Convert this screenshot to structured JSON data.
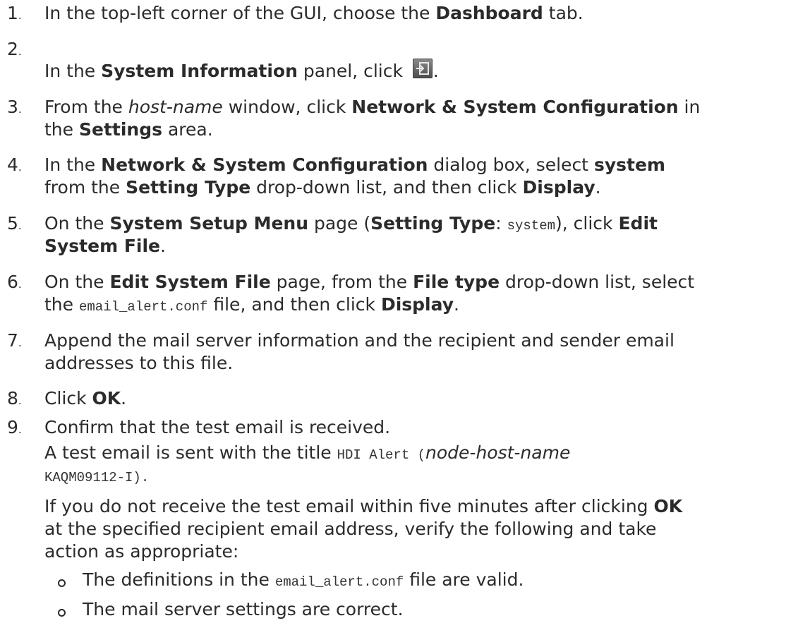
{
  "steps": [
    {
      "num": "1",
      "parts": [
        "In the top-left corner of the GUI, choose the ",
        "Dashboard",
        " tab."
      ]
    },
    {
      "num": "2",
      "parts": [
        "In the ",
        "System Information",
        " panel, click ",
        "."
      ],
      "icon": "panel-open-icon"
    },
    {
      "num": "3",
      "line1": [
        "From the ",
        "host-name",
        " window, click ",
        "Network & System Configuration",
        " in"
      ],
      "line2": [
        "the ",
        "Settings",
        " area."
      ]
    },
    {
      "num": "4",
      "line1": [
        "In the ",
        "Network & System Configuration",
        " dialog box, select ",
        "system"
      ],
      "line2": [
        "from the ",
        "Setting Type",
        " drop-down list, and then click ",
        "Display",
        "."
      ]
    },
    {
      "num": "5",
      "line1": [
        "On the ",
        "System Setup Menu",
        " page (",
        "Setting Type",
        ": ",
        "system",
        "), click ",
        "Edit"
      ],
      "line2": [
        "System File",
        "."
      ]
    },
    {
      "num": "6",
      "line1": [
        "On the ",
        "Edit System File",
        " page, from the ",
        "File type",
        " drop-down list, select"
      ],
      "line2": [
        "the ",
        "email_alert.conf",
        " file, and then click ",
        "Display",
        "."
      ]
    },
    {
      "num": "7",
      "line1": "Append the mail server information and the recipient and sender email",
      "line2": "addresses to this file."
    },
    {
      "num": "8",
      "parts": [
        "Click ",
        "OK",
        "."
      ]
    },
    {
      "num": "9",
      "line1": "Confirm that the test email is received.",
      "result1": [
        "A test email is sent with the title ",
        "HDI Alert (",
        "node-host-name"
      ],
      "result2": "KAQM09112-I).",
      "note1": [
        "If you do not receive the test email within five minutes after clicking ",
        "OK"
      ],
      "note2": "at the specified recipient email address, verify the following and take",
      "note3": "action as appropriate:",
      "bullets": [
        [
          "The definitions in the ",
          "email_alert.conf",
          " file are valid."
        ],
        [
          "The mail server settings are correct."
        ]
      ]
    }
  ]
}
